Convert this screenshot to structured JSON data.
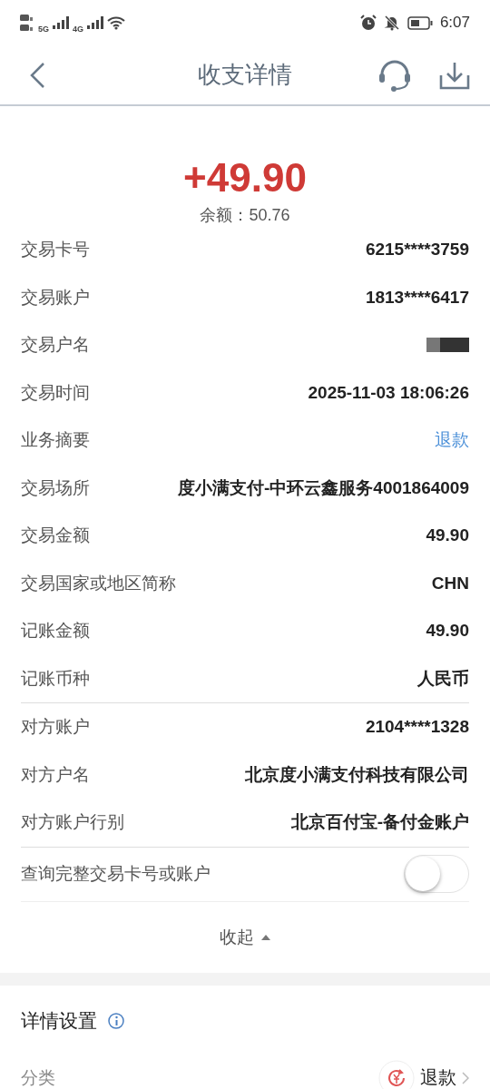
{
  "status_bar": {
    "network_1": "5G",
    "network_2": "4G",
    "time": "6:07"
  },
  "header": {
    "title": "收支详情"
  },
  "amount": "+49.90",
  "balance": "余额：50.76",
  "details": [
    {
      "label": "交易卡号",
      "value": "6215****3759",
      "kind": "text"
    },
    {
      "label": "交易账户",
      "value": "1813****6417",
      "kind": "text"
    },
    {
      "label": "交易户名",
      "kind": "masked"
    },
    {
      "label": "交易时间",
      "value": "2025-11-03 18:06:26",
      "kind": "text"
    },
    {
      "label": "业务摘要",
      "value": "退款",
      "kind": "link"
    },
    {
      "label": "交易场所",
      "value": "度小满支付-中环云鑫服务4001864009",
      "kind": "text"
    },
    {
      "label": "交易金额",
      "value": "49.90",
      "kind": "text"
    },
    {
      "label": "交易国家或地区简称",
      "value": "CHN",
      "kind": "text"
    },
    {
      "label": "记账金额",
      "value": "49.90",
      "kind": "text"
    },
    {
      "label": "记账币种",
      "value": "人民币",
      "kind": "text",
      "divider_after": true
    },
    {
      "label": "对方账户",
      "value": "2104****1328",
      "kind": "text"
    },
    {
      "label": "对方户名",
      "value": "北京度小满支付科技有限公司",
      "kind": "text"
    },
    {
      "label": "对方账户行别",
      "value": "北京百付宝-备付金账户",
      "kind": "text",
      "divider_after": true
    }
  ],
  "full_number_toggle": {
    "label": "查询完整交易卡号或账户",
    "on": false
  },
  "collapse": "收起",
  "settings": {
    "title": "详情设置",
    "category_label": "分类",
    "category_value": "退款"
  }
}
